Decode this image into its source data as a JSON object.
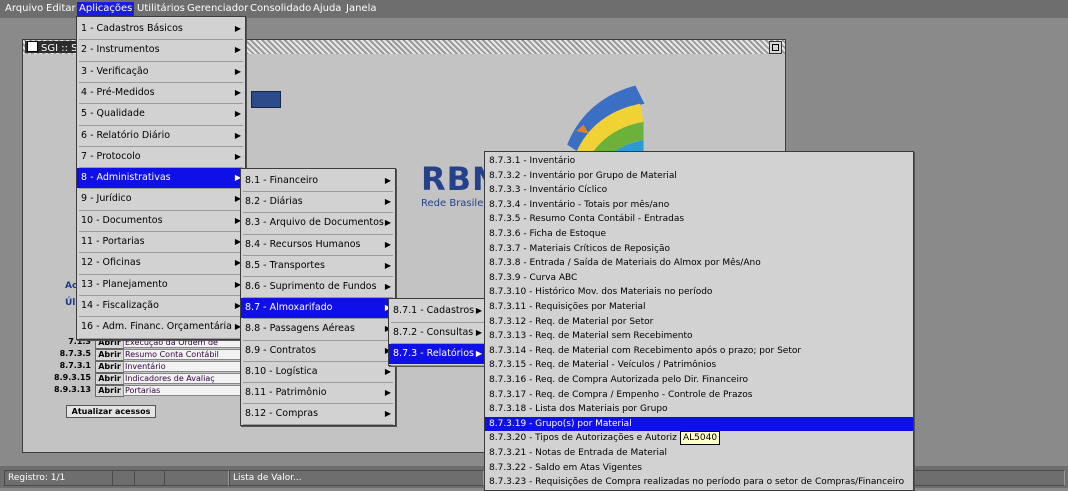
{
  "menubar": [
    "Arquivo",
    "Editar",
    "Aplicações",
    "Utilitários",
    "Gerenciador",
    "Consolidado",
    "Ajuda",
    "Janela"
  ],
  "window": {
    "title": "SGI :: S"
  },
  "logo": {
    "text": "RBN",
    "subtitle": "Rede Brasilei"
  },
  "labels": {
    "ac": "Ac",
    "ul": "Úl"
  },
  "shortcut_rows": [
    {
      "code": "7.1.3",
      "button": "Abrir",
      "desc": "Execução da Ordem de"
    },
    {
      "code": "8.7.3.5",
      "button": "Abrir",
      "desc": "Resumo Conta Contábil"
    },
    {
      "code": "8.7.3.1",
      "button": "Abrir",
      "desc": "Inventário"
    },
    {
      "code": "8.9.3.15",
      "button": "Abrir",
      "desc": "Indicadores de Avaliaç"
    },
    {
      "code": "8.9.3.13",
      "button": "Abrir",
      "desc": "Portarias"
    }
  ],
  "atualizar_label": "Atualizar acessos",
  "statusbar": {
    "registro": "Registro: 1/1",
    "lista": "Lista de Valor..."
  },
  "menu_lvl1": [
    "1 - Cadastros Básicos",
    "2 - Instrumentos",
    "3 - Verificação",
    "4 - Pré-Medidos",
    "5 - Qualidade",
    "6 - Relatório Diário",
    "7 - Protocolo",
    "8 - Administrativas",
    "9 - Jurídico",
    "10 - Documentos",
    "11 - Portarias",
    "12 - Oficinas",
    "13 - Planejamento",
    "14 - Fiscalização",
    "16 - Adm. Financ. Orçamentária"
  ],
  "menu_lvl2": [
    "8.1 - Financeiro",
    "8.2 - Diárias",
    "8.3 - Arquivo de Documentos",
    "8.4 - Recursos Humanos",
    "8.5 - Transportes",
    "8.6 - Suprimento de Fundos",
    "8.7 - Almoxarifado",
    "8.8 - Passagens Aéreas",
    "8.9 - Contratos",
    "8.10 - Logística",
    "8.11 - Patrimônio",
    "8.12 - Compras"
  ],
  "menu_lvl3": [
    "8.7.1 - Cadastros",
    "8.7.2 - Consultas",
    "8.7.3 - Relatórios"
  ],
  "menu_lvl4": [
    "8.7.3.1 - Inventário",
    "8.7.3.2 - Inventário por Grupo de Material",
    "8.7.3.3 - Inventário Cíclico",
    "8.7.3.4 - Inventário - Totais por mês/ano",
    "8.7.3.5 - Resumo Conta Contábil - Entradas",
    "8.7.3.6 - Ficha de Estoque",
    "8.7.3.7 - Materiais Críticos de Reposição",
    "8.7.3.8 - Entrada / Saída de Materiais do Almox por Mês/Ano",
    "8.7.3.9 - Curva ABC",
    "8.7.3.10 - Histórico Mov. dos Materiais no período",
    "8.7.3.11 - Requisições por Material",
    "8.7.3.12 - Req. de Material por Setor",
    "8.7.3.13 - Req. de Material sem Recebimento",
    "8.7.3.14 - Req. de Material com Recebimento após o prazo; por Setor",
    "8.7.3.15 - Req. de Material - Veículos / Patrimônios",
    "8.7.3.16 - Req. de Compra Autorizada pelo Dir. Financeiro",
    "8.7.3.17 - Req. de Compra / Empenho - Controle de Prazos",
    "8.7.3.18 - Lista dos Materiais por Grupo",
    "8.7.3.19 - Grupo(s) por Material",
    "8.7.3.20 - Tipos de Autorizações e Autoriz",
    "8.7.3.21 - Notas de Entrada de Material",
    "8.7.3.22 - Saldo em Atas Vigentes",
    "8.7.3.23 - Requisições de Compra realizadas no período para o setor de Compras/Financeiro"
  ],
  "tooltip": "AL5040",
  "colors": {
    "menu_highlight": "#0f0fe8",
    "menubar_bg": "#6e6e6e",
    "window_bg": "#c3c3c3",
    "logo_blue": "#25418a"
  }
}
